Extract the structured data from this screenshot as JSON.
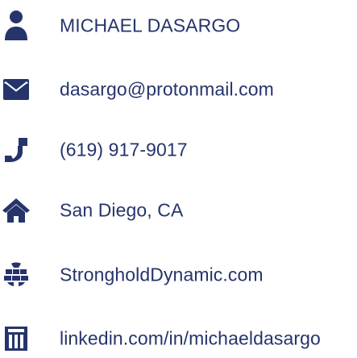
{
  "contact": {
    "name": "MICHAEL DASARGO",
    "email": "dasargo@protonmail.com",
    "phone": "(619) 917-9017",
    "location": "San Diego, CA",
    "website": "StrongholdDynamic.com",
    "linkedin": "linkedin.com/in/michaeldasargo"
  },
  "icons": {
    "name": "user-icon",
    "email": "envelope-icon",
    "phone": "phone-icon",
    "location": "home-icon",
    "website": "globe-icon",
    "linkedin": "linkedin-icon"
  },
  "colors": {
    "icon": "#26346c",
    "text": "#26346c",
    "background": "#ffffff"
  }
}
